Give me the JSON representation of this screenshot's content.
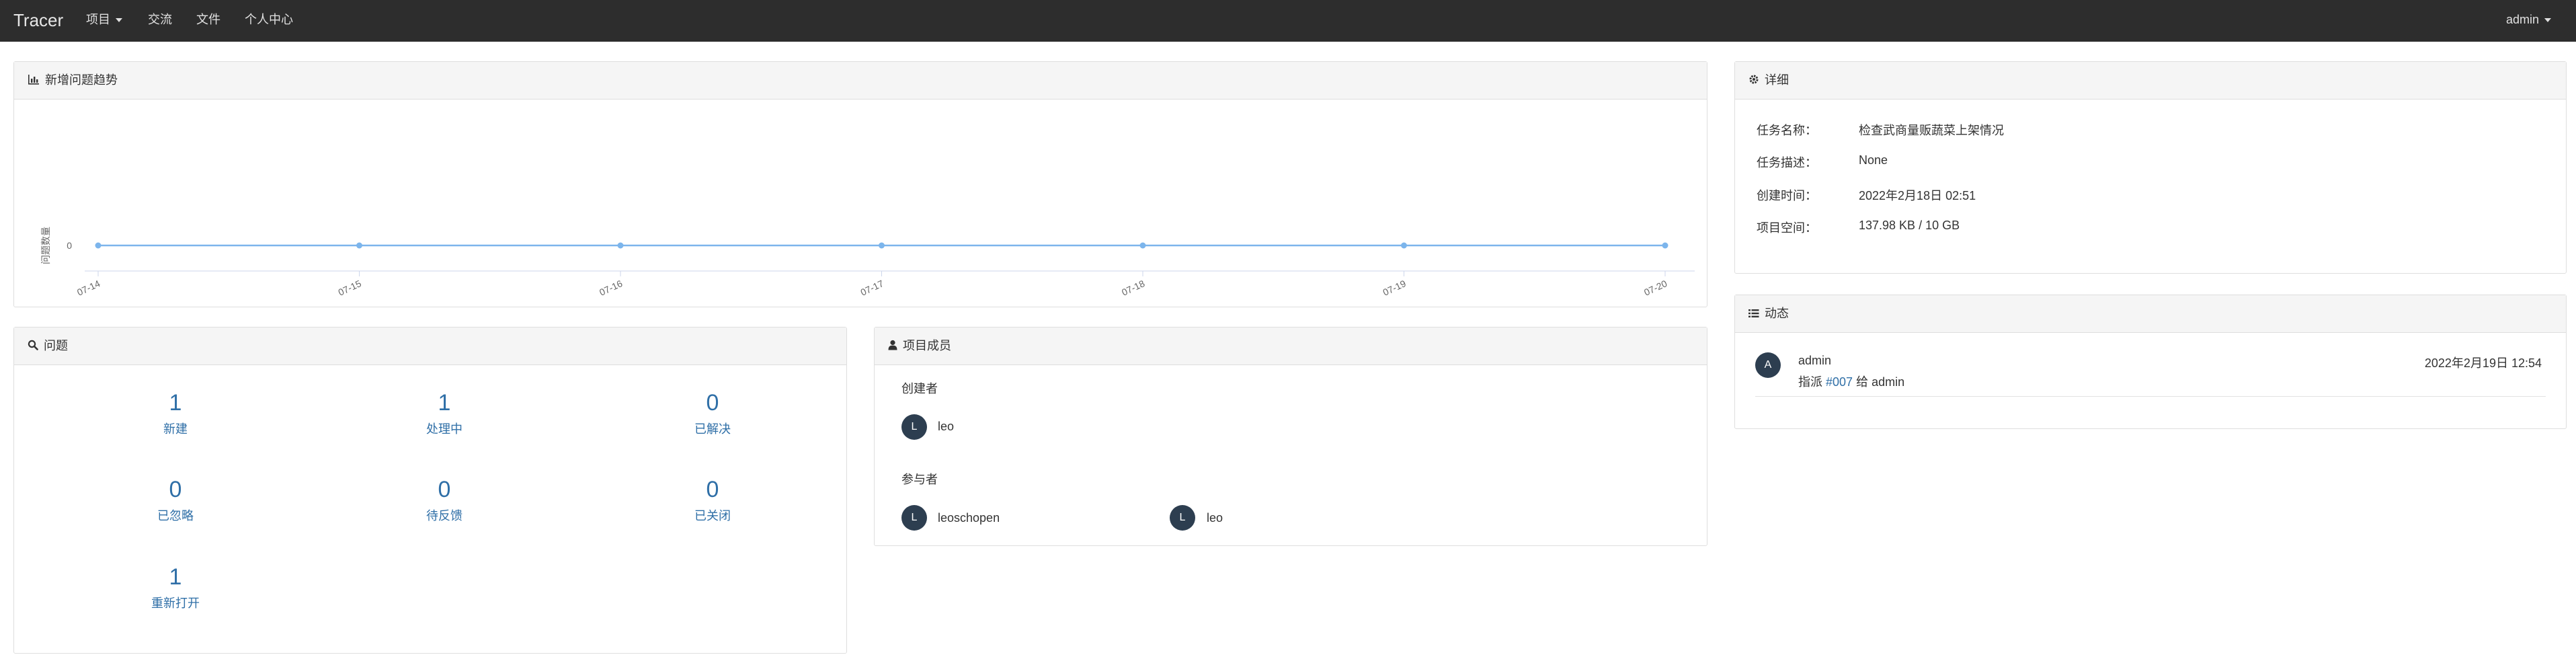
{
  "navbar": {
    "brand": "Tracer",
    "items": [
      {
        "label": "项目",
        "dropdown": true
      },
      {
        "label": "交流"
      },
      {
        "label": "文件"
      },
      {
        "label": "个人中心"
      }
    ],
    "user": "admin"
  },
  "trend_panel": {
    "title": "新增问题趋势",
    "icon": "bar-chart-icon"
  },
  "chart_data": {
    "type": "line",
    "title": "",
    "ylabel": "问题数量",
    "xlabel": "",
    "categories": [
      "07-14",
      "07-15",
      "07-16",
      "07-17",
      "07-18",
      "07-19",
      "07-20"
    ],
    "series": [
      {
        "values": [
          0,
          0,
          0,
          0,
          0,
          0,
          0
        ]
      }
    ],
    "y_ticks": [
      "0"
    ],
    "grid": false,
    "line_color": "#7cb5ec"
  },
  "details_panel": {
    "title": "详细",
    "icon": "gear-icon",
    "rows": [
      {
        "key": "任务名称：",
        "value": "检查武商量贩蔬菜上架情况"
      },
      {
        "key": "任务描述：",
        "value": "None"
      },
      {
        "key": "创建时间：",
        "value": "2022年2月18日 02:51"
      },
      {
        "key": "项目空间：",
        "value": "137.98 KB / 10 GB"
      }
    ]
  },
  "activity_panel": {
    "title": "动态",
    "icon": "list-icon",
    "items": [
      {
        "avatar": "A",
        "user": "admin",
        "action_prefix": "指派",
        "link": "#007",
        "action_suffix": "给 admin",
        "time": "2022年2月19日 12:54"
      }
    ]
  },
  "issues_panel": {
    "title": "问题",
    "icon": "search-icon",
    "stats": [
      {
        "count": "1",
        "label": "新建"
      },
      {
        "count": "1",
        "label": "处理中"
      },
      {
        "count": "0",
        "label": "已解决"
      },
      {
        "count": "0",
        "label": "已忽略"
      },
      {
        "count": "0",
        "label": "待反馈"
      },
      {
        "count": "0",
        "label": "已关闭"
      },
      {
        "count": "1",
        "label": "重新打开"
      }
    ]
  },
  "members_panel": {
    "title": "项目成员",
    "icon": "user-icon",
    "creator_heading": "创建者",
    "creator": {
      "avatar": "L",
      "name": "leo"
    },
    "participants_heading": "参与者",
    "participants": [
      {
        "avatar": "L",
        "name": "leoschopen"
      },
      {
        "avatar": "L",
        "name": "leo"
      }
    ]
  }
}
